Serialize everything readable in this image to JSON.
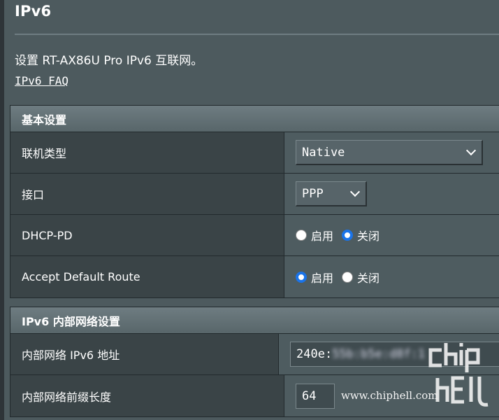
{
  "page": {
    "title": "IPv6",
    "description": "设置 RT-AX86U Pro IPv6 互联网。",
    "faq_link": "IPv6 FAQ"
  },
  "basic": {
    "header": "基本设置",
    "connection_type": {
      "label": "联机类型",
      "value": "Native"
    },
    "interface": {
      "label": "接口",
      "value": "PPP"
    },
    "dhcp_pd": {
      "label": "DHCP-PD",
      "enable": "启用",
      "disable": "关闭",
      "selected": "关闭"
    },
    "accept_default_route": {
      "label": "Accept Default Route",
      "enable": "启用",
      "disable": "关闭",
      "selected": "启用"
    }
  },
  "lan": {
    "header": "IPv6 内部网络设置",
    "address": {
      "label": "内部网络 IPv6 地址",
      "value_prefix": "240e:",
      "value_blurred": "55b:b5e:d8f:1"
    },
    "prefix_length": {
      "label": "内部网络前缀长度",
      "value": "64"
    }
  },
  "watermark": {
    "url": "www.chiphell.com",
    "logo": "chiphell-logo"
  },
  "colors": {
    "background": "#4d5a5e",
    "label_cell": "#3a4447",
    "radio_selected": "#1a73e8"
  }
}
